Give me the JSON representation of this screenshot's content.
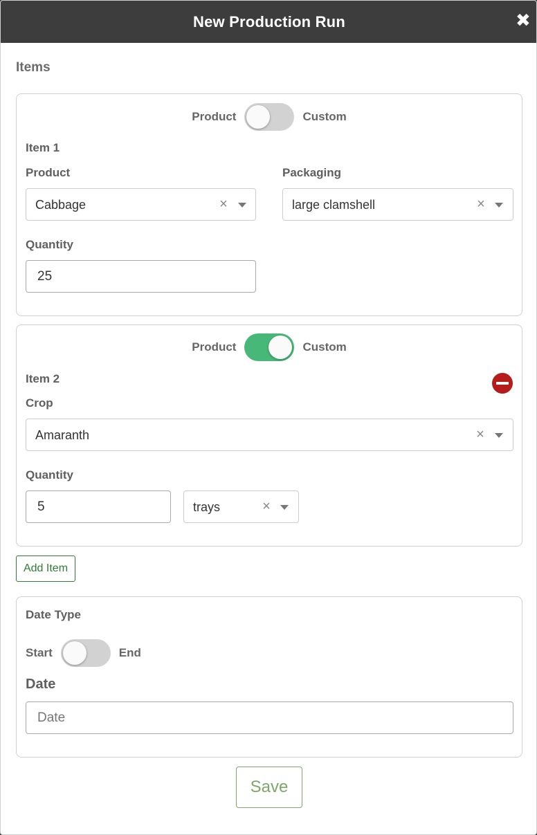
{
  "modal": {
    "title": "New Production Run",
    "close_glyph": "✖"
  },
  "items_section": {
    "title": "Items"
  },
  "item1": {
    "toggle": {
      "left_label": "Product",
      "right_label": "Custom",
      "state": "Product"
    },
    "heading": "Item 1",
    "product": {
      "label": "Product",
      "value": "Cabbage"
    },
    "packaging": {
      "label": "Packaging",
      "value": "large clamshell"
    },
    "quantity": {
      "label": "Quantity",
      "value": "25"
    }
  },
  "item2": {
    "toggle": {
      "left_label": "Product",
      "right_label": "Custom",
      "state": "Custom"
    },
    "heading": "Item 2",
    "crop": {
      "label": "Crop",
      "value": "Amaranth"
    },
    "quantity": {
      "label": "Quantity",
      "value": "5"
    },
    "unit": {
      "value": "trays"
    }
  },
  "add_item": {
    "label": "Add Item"
  },
  "date_section": {
    "heading": "Date Type",
    "toggle": {
      "left_label": "Start",
      "right_label": "End",
      "state": "Start"
    },
    "date_label": "Date",
    "date_input": {
      "placeholder": "Date",
      "value": ""
    }
  },
  "save": {
    "label": "Save"
  },
  "glyphs": {
    "clear": "×"
  },
  "colors": {
    "header_bg": "#3d3d3d",
    "toggle_on": "#48b878",
    "remove": "#b71c1c",
    "save": "#7da86a",
    "add_item": "#2e7d32"
  }
}
